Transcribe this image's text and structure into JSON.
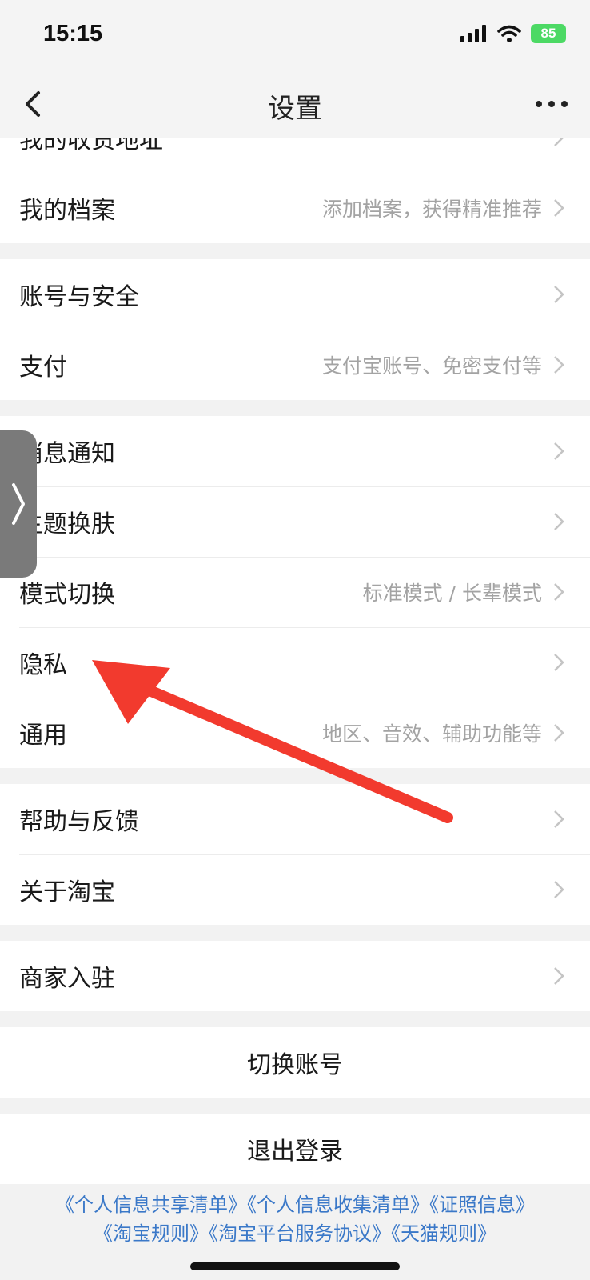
{
  "status_bar": {
    "time": "15:15",
    "battery": "85"
  },
  "nav": {
    "title": "设置"
  },
  "groups": [
    {
      "rows": [
        {
          "label": "我的收货地址",
          "hint": ""
        },
        {
          "label": "我的档案",
          "hint": "添加档案，获得精准推荐"
        }
      ]
    },
    {
      "rows": [
        {
          "label": "账号与安全",
          "hint": ""
        },
        {
          "label": "支付",
          "hint": "支付宝账号、免密支付等"
        }
      ]
    },
    {
      "rows": [
        {
          "label": "消息通知",
          "hint": ""
        },
        {
          "label": "主题换肤",
          "hint": ""
        },
        {
          "label": "模式切换",
          "hint": "标准模式 / 长辈模式"
        },
        {
          "label": "隐私",
          "hint": ""
        },
        {
          "label": "通用",
          "hint": "地区、音效、辅助功能等"
        }
      ]
    },
    {
      "rows": [
        {
          "label": "帮助与反馈",
          "hint": ""
        },
        {
          "label": "关于淘宝",
          "hint": ""
        }
      ]
    },
    {
      "rows": [
        {
          "label": "商家入驻",
          "hint": ""
        }
      ]
    }
  ],
  "buttons": {
    "switch_account": "切换账号",
    "logout": "退出登录"
  },
  "footer": {
    "line1": [
      "《个人信息共享清单》",
      "《个人信息收集清单》",
      "《证照信息》"
    ],
    "line2": [
      "《淘宝规则》",
      "《淘宝平台服务协议》",
      "《天猫规则》"
    ]
  },
  "icons": {
    "back": "chevron-left-icon",
    "more": "more-horizontal-icon",
    "chevron": "chevron-right-icon",
    "handle": "side-expand-icon"
  },
  "colors": {
    "arrow": "#f23a2e",
    "link": "#3a78c8",
    "hint": "#a3a3a3"
  }
}
